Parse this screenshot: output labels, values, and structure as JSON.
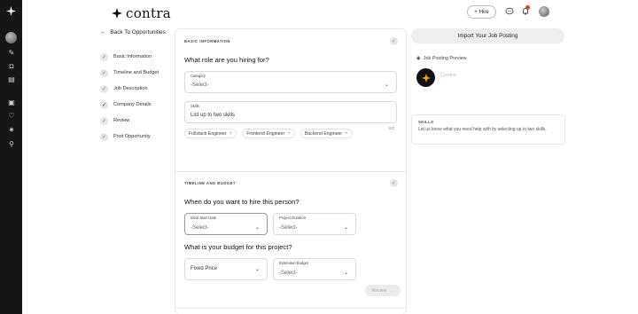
{
  "brand": {
    "name": "contra"
  },
  "header": {
    "hire_label": "Hire",
    "notification_count": "1"
  },
  "sidebar": {
    "back_label": "Back To Opportunities",
    "steps": [
      {
        "label": "Basic Information"
      },
      {
        "label": "Timeline and Budget"
      },
      {
        "label": "Job Description"
      },
      {
        "label": "Company Details"
      },
      {
        "label": "Review"
      },
      {
        "label": "Post Opportunity"
      }
    ]
  },
  "basic": {
    "section_title": "BASIC INFORMATION",
    "question": "What role are you hiring for?",
    "category": {
      "label": "Category",
      "value": "-Select-"
    },
    "skills": {
      "label": "Skills",
      "placeholder": "List up to two skills",
      "counter": "0/2"
    },
    "suggestions": [
      "Fullstack Engineer",
      "Frontend Engineer",
      "Backend Engineer"
    ]
  },
  "timeline": {
    "section_title": "TIMELINE AND BUDGET",
    "question": "When do you want to hire this person?",
    "start_date": {
      "label": "Ideal Start Date",
      "value": "-Select-"
    },
    "duration": {
      "label": "Project Duration",
      "value": "-Select-"
    },
    "budget_question": "What is your budget for this project?",
    "price_type": {
      "value": "Fixed Price"
    },
    "estimated_budget": {
      "label": "Estimated Budget",
      "value": "-Select-"
    },
    "review_label": "Review"
  },
  "right_panel": {
    "import_label": "Import Your Job Posting",
    "preview_label": "Job Posting Preview",
    "preview_name": "Contra",
    "skills_title": "SKILLS",
    "skills_desc": "Let us know what you need help with by selecting up to two skills."
  },
  "colors": {
    "accent": "#f5a623",
    "dark": "#161616",
    "badge": "#e53935"
  }
}
